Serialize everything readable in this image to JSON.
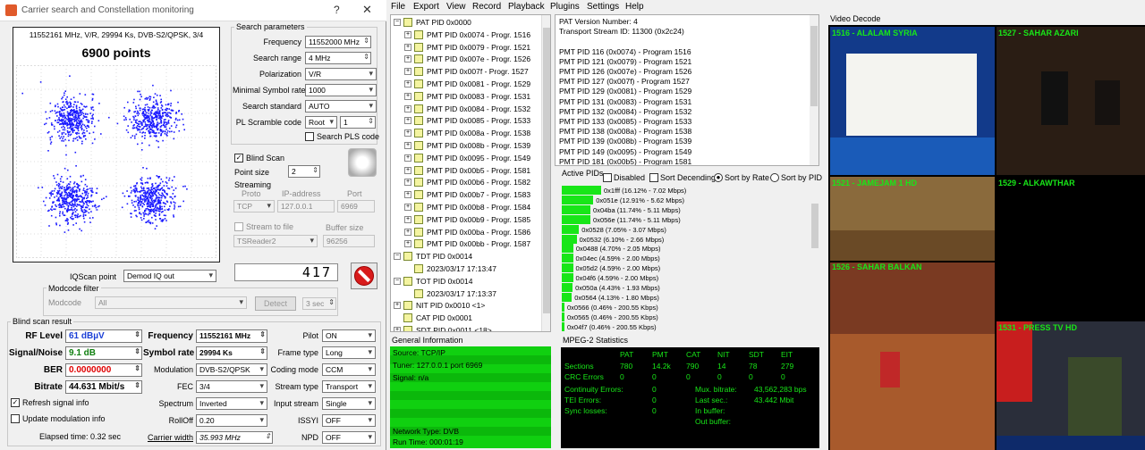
{
  "window": {
    "title": "Carrier search and Constellation monitoring",
    "help_label": "?",
    "close_label": "✕"
  },
  "constellation": {
    "info": "11552161 MHz, V/R, 29994 Ks, DVB-S2/QPSK, 3/4",
    "points": "6900 points"
  },
  "search_params": {
    "title": "Search parameters",
    "frequency_label": "Frequency",
    "frequency": "11552000 MHz",
    "range_label": "Search range",
    "range": "4 MHz",
    "polarization_label": "Polarization",
    "polarization": "V/R",
    "min_sr_label": "Minimal Symbol rate",
    "min_sr": "1000",
    "standard_label": "Search standard",
    "standard": "AUTO",
    "scramble_label": "PL Scramble code",
    "scramble": "Root",
    "scramble_num": "1",
    "pls_label": "Search PLS code"
  },
  "blind": {
    "blind_scan_label": "Blind Scan",
    "point_size_label": "Point size",
    "point_size": "2",
    "streaming_label": "Streaming",
    "proto_label": "Proto",
    "ip_label": "IP-address",
    "port_label": "Port",
    "proto": "TCP",
    "ip": "127.0.0.1",
    "port": "6969",
    "stream_to_file_label": "Stream to file",
    "buffer_label": "Buffer size",
    "reader": "TSReader2",
    "buffer": "96256"
  },
  "counter": "417",
  "iqscan": {
    "label": "IQScan point",
    "value": "Demod IQ out"
  },
  "modcode": {
    "group_label": "Modcode filter",
    "label": "Modcode",
    "value": "All",
    "detect_label": "Detect",
    "sec": "3 sec"
  },
  "result": {
    "group_label": "Blind scan result",
    "rf_label": "RF Level",
    "rf": "61 dBµV",
    "sn_label": "Signal/Noise",
    "sn": "9.1 dB",
    "ber_label": "BER",
    "ber": "0.0000000",
    "bitrate_label": "Bitrate",
    "bitrate": "44.631 Mbit/s",
    "refresh_label": "Refresh signal info",
    "update_label": "Update modulation info",
    "elapsed": "Elapsed time: 0.32 sec",
    "freq_label": "Frequency",
    "freq": "11552161 MHz",
    "sr_label": "Symbol rate",
    "sr": "29994 Ks",
    "mod_label": "Modulation",
    "mod": "DVB-S2/QPSK",
    "fec_label": "FEC",
    "fec": "3/4",
    "spectrum_label": "Spectrum",
    "spectrum": "Inverted",
    "rolloff_label": "RollOff",
    "rolloff": "0.20",
    "cw_label": "Carrier width",
    "cw": "35.993 MHz",
    "pilot_label": "Pilot",
    "pilot": "ON",
    "frame_label": "Frame type",
    "frame": "Long",
    "coding_label": "Coding mode",
    "coding": "CCM",
    "stream_label": "Stream type",
    "stream": "Transport",
    "input_label": "Input stream",
    "input": "Single",
    "issyi_label": "ISSYI",
    "issyi": "OFF",
    "npd_label": "NPD",
    "npd": "OFF"
  },
  "menu": [
    "File",
    "Export",
    "View",
    "Record",
    "Playback",
    "Plugins",
    "Settings",
    "Help"
  ],
  "tree": [
    {
      "t": "PAT PID 0x0000",
      "lvl": 0,
      "sign": "−"
    },
    {
      "t": "PMT PID 0x0074 - Progr. 1516",
      "lvl": 1,
      "sign": "+"
    },
    {
      "t": "PMT PID 0x0079 - Progr. 1521",
      "lvl": 1,
      "sign": "+"
    },
    {
      "t": "PMT PID 0x007e - Progr. 1526",
      "lvl": 1,
      "sign": "+"
    },
    {
      "t": "PMT PID 0x007f - Progr. 1527",
      "lvl": 1,
      "sign": "+"
    },
    {
      "t": "PMT PID 0x0081 - Progr. 1529",
      "lvl": 1,
      "sign": "+"
    },
    {
      "t": "PMT PID 0x0083 - Progr. 1531",
      "lvl": 1,
      "sign": "+"
    },
    {
      "t": "PMT PID 0x0084 - Progr. 1532",
      "lvl": 1,
      "sign": "+"
    },
    {
      "t": "PMT PID 0x0085 - Progr. 1533",
      "lvl": 1,
      "sign": "+"
    },
    {
      "t": "PMT PID 0x008a - Progr. 1538",
      "lvl": 1,
      "sign": "+"
    },
    {
      "t": "PMT PID 0x008b - Progr. 1539",
      "lvl": 1,
      "sign": "+"
    },
    {
      "t": "PMT PID 0x0095 - Progr. 1549",
      "lvl": 1,
      "sign": "+"
    },
    {
      "t": "PMT PID 0x00b5 - Progr. 1581",
      "lvl": 1,
      "sign": "+"
    },
    {
      "t": "PMT PID 0x00b6 - Progr. 1582",
      "lvl": 1,
      "sign": "+"
    },
    {
      "t": "PMT PID 0x00b7 - Progr. 1583",
      "lvl": 1,
      "sign": "+"
    },
    {
      "t": "PMT PID 0x00b8 - Progr. 1584",
      "lvl": 1,
      "sign": "+"
    },
    {
      "t": "PMT PID 0x00b9 - Progr. 1585",
      "lvl": 1,
      "sign": "+"
    },
    {
      "t": "PMT PID 0x00ba - Progr. 1586",
      "lvl": 1,
      "sign": "+"
    },
    {
      "t": "PMT PID 0x00bb - Progr. 1587",
      "lvl": 1,
      "sign": "+"
    },
    {
      "t": "TDT PID 0x0014",
      "lvl": 0,
      "sign": "−"
    },
    {
      "t": "2023/03/17 17:13:47",
      "lvl": 1,
      "sign": ""
    },
    {
      "t": "TOT PID 0x0014",
      "lvl": 0,
      "sign": "−"
    },
    {
      "t": "2023/03/17 17:13:37",
      "lvl": 1,
      "sign": ""
    },
    {
      "t": "NIT PID 0x0010 <1>",
      "lvl": 0,
      "sign": "+"
    },
    {
      "t": "CAT PID 0x0001",
      "lvl": 0,
      "sign": ""
    },
    {
      "t": "SDT PID 0x0011 <18>",
      "lvl": 0,
      "sign": "+"
    }
  ],
  "pat_lines": [
    "PAT Version Number: 4",
    "Transport Stream ID: 11300 (0x2c24)",
    "",
    "PMT PID 116 (0x0074) - Program 1516",
    "PMT PID 121 (0x0079) - Program 1521",
    "PMT PID 126 (0x007e) - Program 1526",
    "PMT PID 127 (0x007f) - Program 1527",
    "PMT PID 129 (0x0081) - Program 1529",
    "PMT PID 131 (0x0083) - Program 1531",
    "PMT PID 132 (0x0084) - Program 1532",
    "PMT PID 133 (0x0085) - Program 1533",
    "PMT PID 138 (0x008a) - Program 1538",
    "PMT PID 139 (0x008b) - Program 1539",
    "PMT PID 149 (0x0095) - Program 1549",
    "PMT PID 181 (0x00b5) - Program 1581"
  ],
  "active_pids": {
    "label": "Active PIDs",
    "disabled_label": "Disabled",
    "sort_desc_label": "Sort Decending",
    "sort_rate_label": "Sort by Rate",
    "sort_pid_label": "Sort by PID",
    "items": [
      {
        "t": "0x1fff (16.12% - 7.02 Mbps)",
        "p": 16.12
      },
      {
        "t": "0x051e (12.91% - 5.62 Mbps)",
        "p": 12.91
      },
      {
        "t": "0x04ba (11.74% - 5.11 Mbps)",
        "p": 11.74
      },
      {
        "t": "0x056e (11.74% - 5.11 Mbps)",
        "p": 11.74
      },
      {
        "t": "0x0528 (7.05% - 3.07 Mbps)",
        "p": 7.05
      },
      {
        "t": "0x0532 (6.10% - 2.66 Mbps)",
        "p": 6.1
      },
      {
        "t": "0x0488 (4.70% - 2.05 Mbps)",
        "p": 4.7
      },
      {
        "t": "0x04ec (4.59% - 2.00 Mbps)",
        "p": 4.59
      },
      {
        "t": "0x05d2 (4.59% - 2.00 Mbps)",
        "p": 4.59
      },
      {
        "t": "0x04f6 (4.59% - 2.00 Mbps)",
        "p": 4.59
      },
      {
        "t": "0x050a (4.43% - 1.93 Mbps)",
        "p": 4.43
      },
      {
        "t": "0x0564 (4.13% - 1.80 Mbps)",
        "p": 4.13
      },
      {
        "t": "0x0566 (0.46% - 200.55 Kbps)",
        "p": 0.46
      },
      {
        "t": "0x0565 (0.46% - 200.55 Kbps)",
        "p": 0.46
      },
      {
        "t": "0x04f7 (0.46% - 200.55 Kbps)",
        "p": 0.46
      }
    ]
  },
  "general_info": {
    "title": "General Information",
    "source": "Source: TCP/IP",
    "tuner": "Tuner: 127.0.0.1 port 6969",
    "signal": "Signal: n/a",
    "network": "Network Type: DVB",
    "runtime": "Run Time: 000:01:19"
  },
  "mpeg": {
    "title": "MPEG-2 Statistics",
    "headers": [
      "PAT",
      "PMT",
      "CAT",
      "NIT",
      "SDT",
      "EIT"
    ],
    "sections_label": "Sections",
    "sections": [
      "780",
      "14.2k",
      "790",
      "14",
      "78",
      "279"
    ],
    "crc_label": "CRC Errors",
    "crc": [
      "0",
      "0",
      "0",
      "0",
      "0",
      "0"
    ],
    "cont_label": "Continuity Errors:",
    "cont": "0",
    "tei_label": "TEI Errors:",
    "tei": "0",
    "sync_label": "Sync losses:",
    "sync": "0",
    "mux_label": "Mux. bitrate:",
    "mux": "43,562,283 bps",
    "last_label": "Last sec.:",
    "last": "43.442 Mbit",
    "inbuf_label": "In buffer:",
    "outbuf_label": "Out buffer:"
  },
  "video": {
    "title": "Video Decode",
    "tiles": [
      "1516 - ALALAM SYRIA",
      "1527 - SAHAR AZARI",
      "1521 - JAMEJAM 1 HD",
      "1529 - ALKAWTHAR",
      "1526 - SAHAR BALKAN",
      "1531 - PRESS TV HD"
    ]
  },
  "colors": {
    "accent_green": "#18e618",
    "constellation_blue": "#1a1aff"
  }
}
